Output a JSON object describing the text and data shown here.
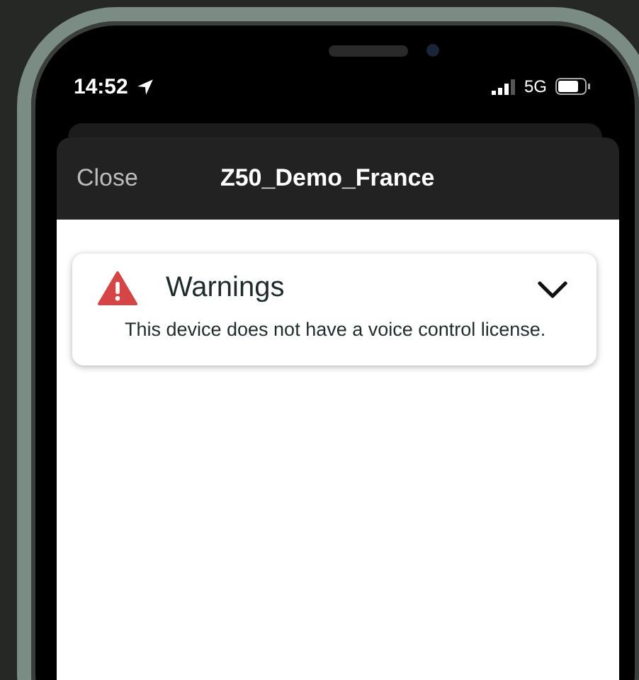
{
  "status_bar": {
    "time": "14:52",
    "network": "5G"
  },
  "sheet": {
    "close": "Close",
    "title": "Z50_Demo_France"
  },
  "warnings": {
    "title": "Warnings",
    "expanded": true,
    "message": "This device does not have a voice control license."
  }
}
